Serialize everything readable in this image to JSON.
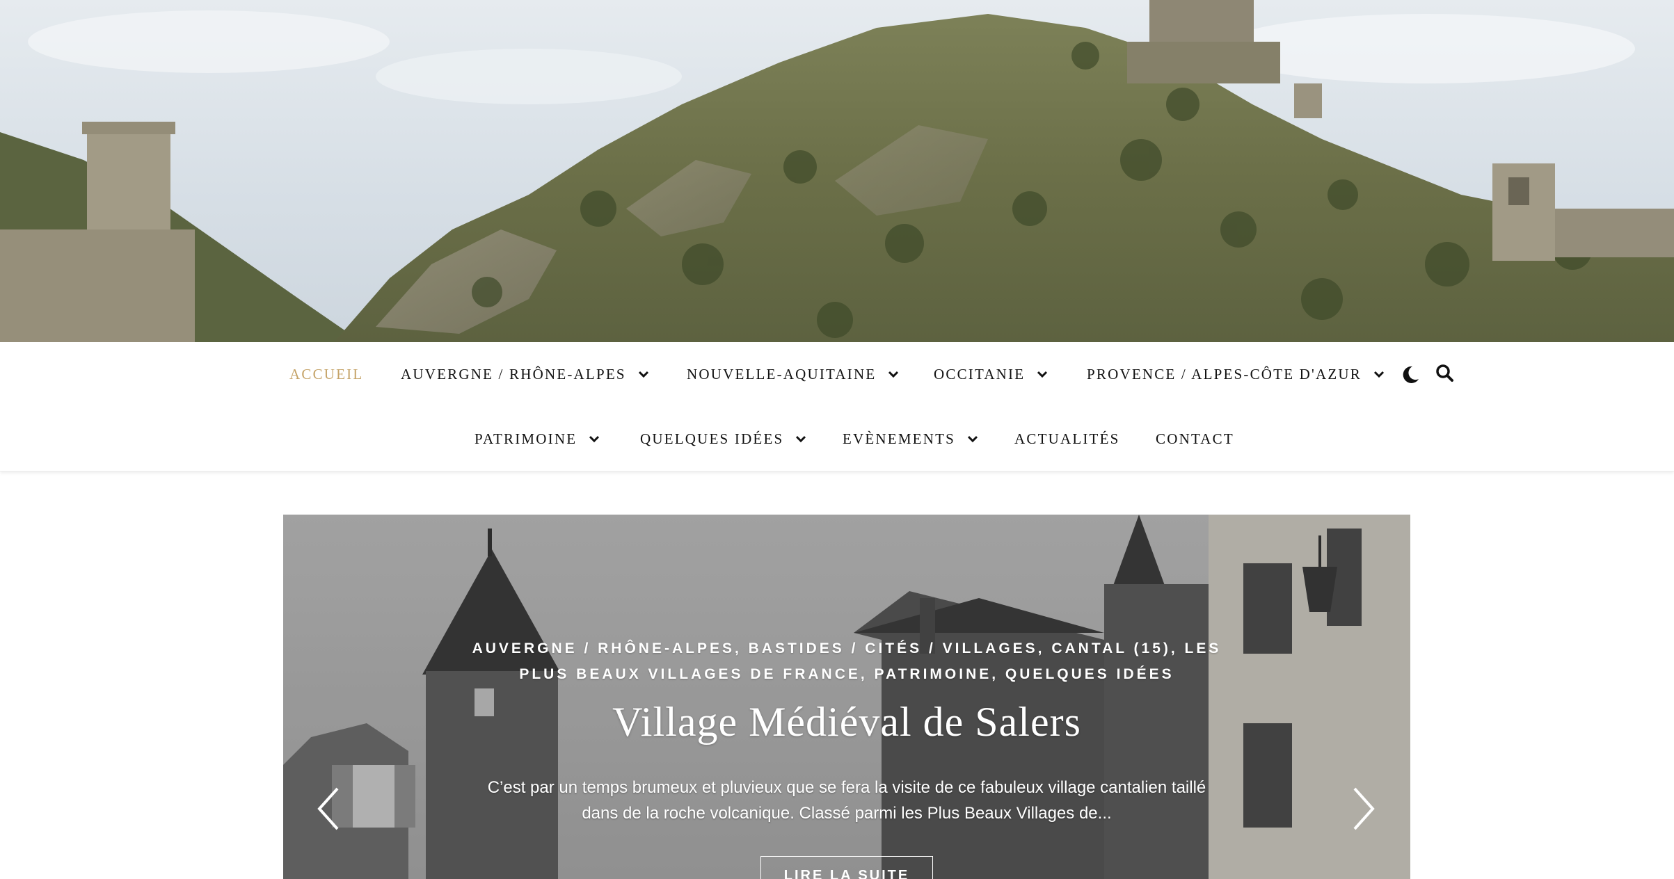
{
  "hero": {
    "image_desc_icon": "castle-hill-photo-icon"
  },
  "nav": {
    "row1": [
      {
        "label": "ACCUEIL",
        "active": true,
        "dropdown": false
      },
      {
        "label": "AUVERGNE / RHÔNE-ALPES",
        "dropdown": true
      },
      {
        "label": "NOUVELLE-AQUITAINE",
        "dropdown": true
      },
      {
        "label": "OCCITANIE",
        "dropdown": true
      },
      {
        "label": "PROVENCE / ALPES-CÔTE D'AZUR",
        "dropdown": true
      }
    ],
    "row2": [
      {
        "label": "PATRIMOINE",
        "dropdown": true
      },
      {
        "label": "QUELQUES IDÉES",
        "dropdown": true
      },
      {
        "label": "EVÈNEMENTS",
        "dropdown": true
      },
      {
        "label": "ACTUALITÉS",
        "dropdown": false
      },
      {
        "label": "CONTACT",
        "dropdown": false
      }
    ],
    "tools": {
      "dark_mode_icon": "moon-icon",
      "search_icon": "search-icon"
    },
    "colors": {
      "active": "#c5a368",
      "text": "#111111"
    }
  },
  "slider": {
    "categories": "AUVERGNE / RHÔNE-ALPES, BASTIDES / CITÉS / VILLAGES, CANTAL (15), LES PLUS BEAUX VILLAGES DE FRANCE, PATRIMOINE, QUELQUES IDÉES",
    "title": "Village Médiéval de Salers",
    "excerpt": "C’est par un temps brumeux et pluvieux que se fera la visite de ce fabuleux village cantalien taillé dans de la roche volcanique. Classé parmi les Plus Beaux Villages de...",
    "button": "LIRE LA SUITE",
    "prev_icon": "chevron-left-icon",
    "next_icon": "chevron-right-icon"
  }
}
